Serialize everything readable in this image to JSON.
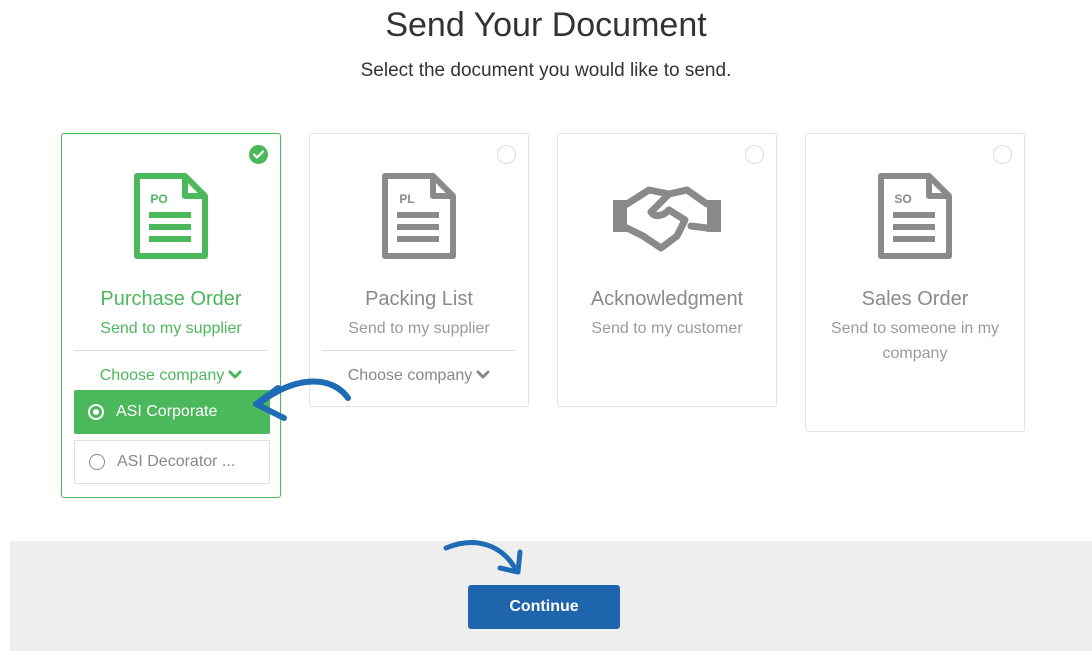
{
  "page": {
    "title": "Send Your Document",
    "subtitle": "Select the document you would like to send."
  },
  "cards": [
    {
      "icon_label": "PO",
      "icon": "purchase-order-document-icon",
      "title": "Purchase Order",
      "description": "Send to my supplier",
      "selected": true,
      "choose_label": "Choose company",
      "companies": [
        {
          "label": "ASI Corporate",
          "selected": true
        },
        {
          "label": "ASI Decorator ...",
          "selected": false
        }
      ]
    },
    {
      "icon_label": "PL",
      "icon": "packing-list-document-icon",
      "title": "Packing List",
      "description": "Send to my supplier",
      "selected": false,
      "choose_label": "Choose company"
    },
    {
      "icon": "handshake-icon",
      "title": "Acknowledgment",
      "description": "Send to my customer",
      "selected": false
    },
    {
      "icon_label": "SO",
      "icon": "sales-order-document-icon",
      "title": "Sales Order",
      "description": "Send to someone in my company",
      "selected": false
    }
  ],
  "footer": {
    "continue_label": "Continue"
  },
  "colors": {
    "selected_green": "#4cb85c",
    "inactive_gray": "#8a8a8a",
    "button_blue": "#1f65ad",
    "annotation_arrow_blue": "#1e6cb6",
    "footer_bg": "#eeeeee"
  }
}
